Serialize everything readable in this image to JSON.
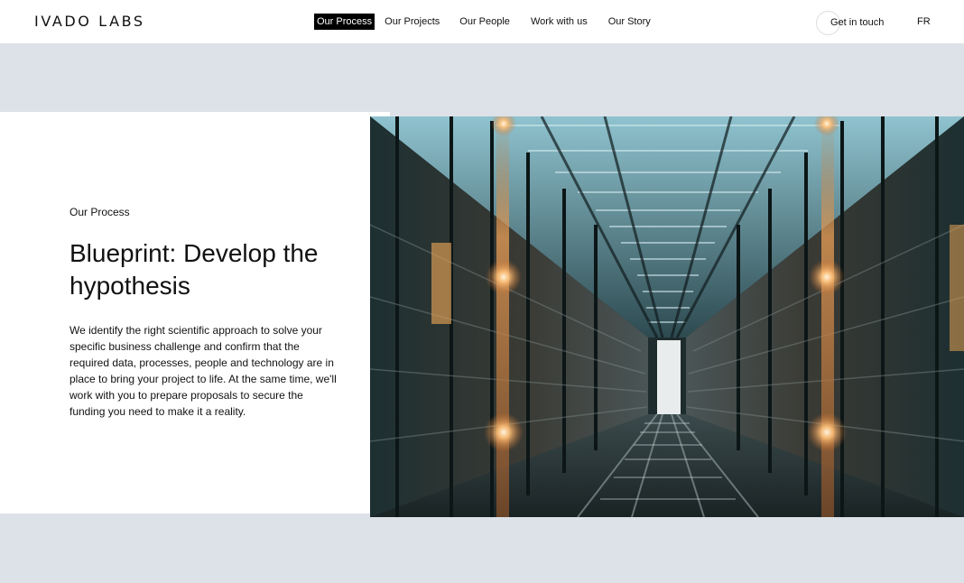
{
  "header": {
    "logo": "IVADO LABS",
    "nav": [
      {
        "label": "Our Process",
        "active": true
      },
      {
        "label": "Our Projects",
        "active": false
      },
      {
        "label": "Our People",
        "active": false
      },
      {
        "label": "Work with us",
        "active": false
      },
      {
        "label": "Our Story",
        "active": false
      }
    ],
    "cta_label": "Get in touch",
    "language_toggle": "FR"
  },
  "section": {
    "eyebrow": "Our Process",
    "title": "Blueprint: Develop the hypothesis",
    "body": "We identify the right scientific approach to solve your specific business challenge and confirm that the required data, processes, people and technology are in place to bring your project to life. At the same time, we'll work with you to prepare proposals to secure the funding you need to make it a reality."
  },
  "colors": {
    "page_background": "#dde2e8",
    "header_background": "#ffffff",
    "active_nav_background": "#000000",
    "text": "#111111"
  }
}
